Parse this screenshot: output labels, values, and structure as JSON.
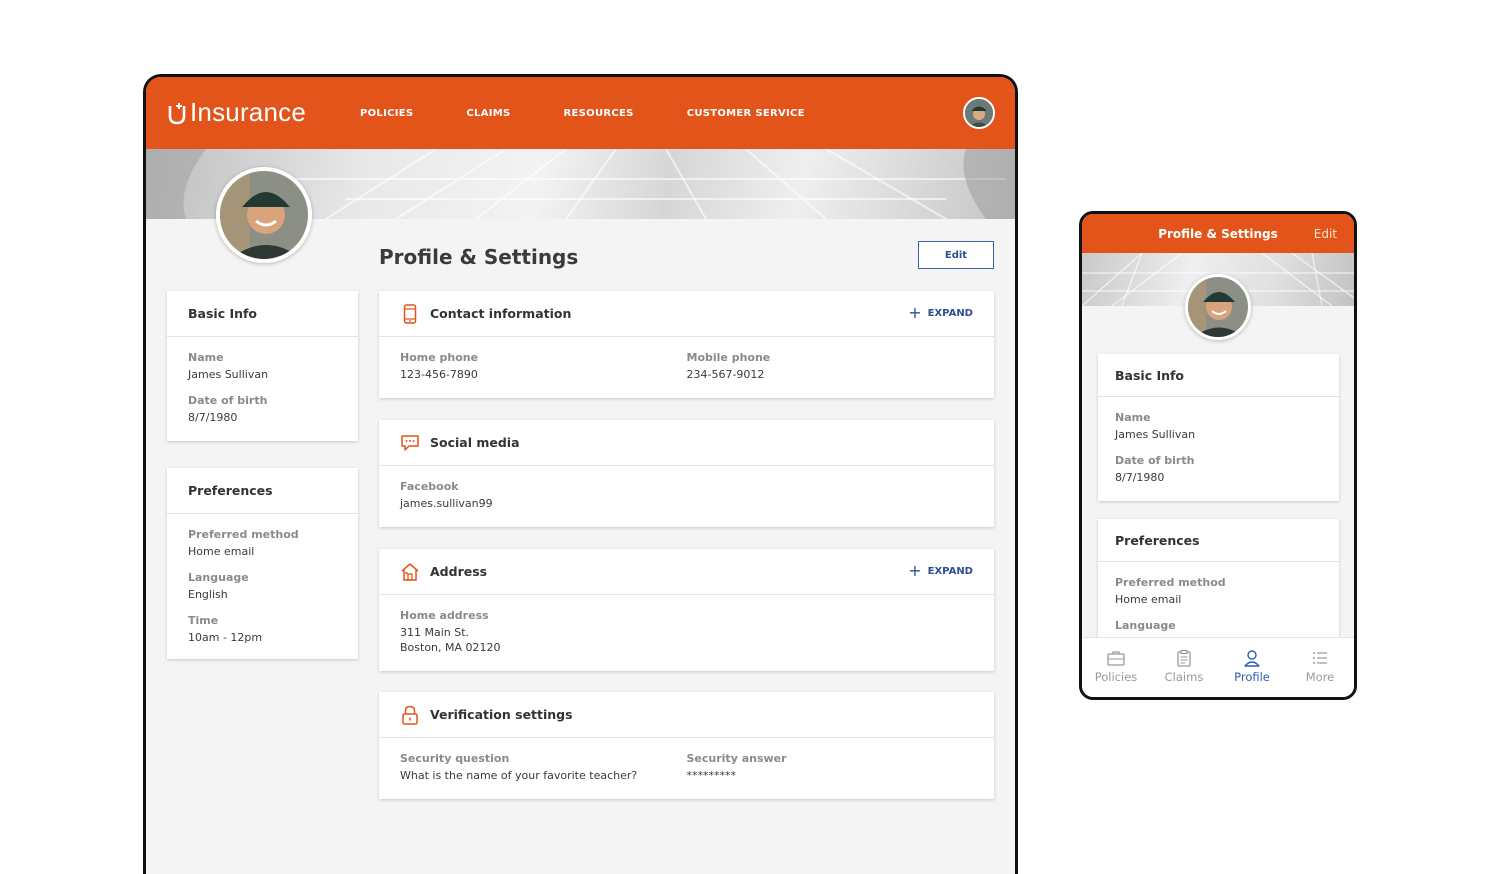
{
  "brand": {
    "logo_text": "Insurance",
    "accent": "#e2541a",
    "link_color": "#2d4f92"
  },
  "nav": {
    "items": [
      {
        "label": "POLICIES"
      },
      {
        "label": "CLAIMS"
      },
      {
        "label": "RESOURCES"
      },
      {
        "label": "CUSTOMER SERVICE"
      }
    ]
  },
  "page": {
    "title": "Profile & Settings",
    "edit_label": "Edit"
  },
  "basic_info": {
    "title": "Basic Info",
    "name_label": "Name",
    "name_value": "James Sullivan",
    "dob_label": "Date of birth",
    "dob_value": "8/7/1980"
  },
  "preferences": {
    "title": "Preferences",
    "method_label": "Preferred method",
    "method_value": "Home email",
    "language_label": "Language",
    "language_value": "English",
    "time_label": "Time",
    "time_value": "10am - 12pm"
  },
  "contact": {
    "title": "Contact information",
    "expand_label": "EXPAND",
    "icon": "phone-icon",
    "home_label": "Home phone",
    "home_value": "123-456-7890",
    "mobile_label": "Mobile phone",
    "mobile_value": "234-567-9012"
  },
  "social": {
    "title": "Social media",
    "icon": "chat-icon",
    "facebook_label": "Facebook",
    "facebook_value": "james.sullivan99"
  },
  "address": {
    "title": "Address",
    "expand_label": "EXPAND",
    "icon": "home-icon",
    "home_label": "Home address",
    "line1": "311 Main St.",
    "line2": "Boston, MA 02120"
  },
  "verification": {
    "title": "Verification settings",
    "icon": "lock-icon",
    "question_label": "Security question",
    "question_value": "What is the name of your favorite teacher?",
    "answer_label": "Security answer",
    "answer_value": "*********"
  },
  "mobile": {
    "title": "Profile & Settings",
    "edit_label": "Edit",
    "tabs": [
      {
        "label": "Policies",
        "icon": "briefcase-icon"
      },
      {
        "label": "Claims",
        "icon": "clipboard-icon"
      },
      {
        "label": "Profile",
        "icon": "person-icon",
        "active": true
      },
      {
        "label": "More",
        "icon": "list-icon"
      }
    ]
  }
}
